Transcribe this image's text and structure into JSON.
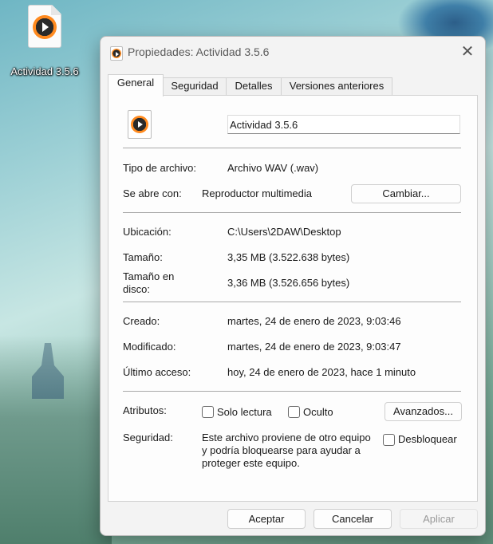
{
  "desktop": {
    "file_label": "Actividad 3.5.6"
  },
  "window": {
    "title": "Propiedades: Actividad 3.5.6",
    "close_glyph": "✕"
  },
  "tabs": [
    {
      "label": "General",
      "active": true
    },
    {
      "label": "Seguridad"
    },
    {
      "label": "Detalles"
    },
    {
      "label": "Versiones anteriores"
    }
  ],
  "general": {
    "file_name": "Actividad 3.5.6",
    "file_type": {
      "label": "Tipo de archivo:",
      "value": "Archivo WAV (.wav)"
    },
    "opens_with": {
      "label": "Se abre con:",
      "value": "Reproductor multimedia",
      "button": "Cambiar..."
    },
    "location": {
      "label": "Ubicación:",
      "value": "C:\\Users\\2DAW\\Desktop"
    },
    "size": {
      "label": "Tamaño:",
      "value": "3,35 MB (3.522.638 bytes)"
    },
    "size_on_disk": {
      "label_line1": "Tamaño en",
      "label_line2": "disco:",
      "value": "3,36 MB (3.526.656 bytes)"
    },
    "created": {
      "label": "Creado:",
      "value": "martes, 24 de enero de 2023, 9:03:46"
    },
    "modified": {
      "label": "Modificado:",
      "value": "martes, 24 de enero de 2023, 9:03:47"
    },
    "accessed": {
      "label": "Último acceso:",
      "value": "hoy, 24 de enero de 2023, hace 1 minuto"
    },
    "attributes": {
      "label": "Atributos:",
      "readonly": "Solo lectura",
      "hidden": "Oculto",
      "advanced_button": "Avanzados..."
    },
    "security": {
      "label": "Seguridad:",
      "line1": "Este archivo proviene de otro equipo",
      "line2": "y podría bloquearse para ayudar a",
      "line3": "proteger este equipo.",
      "unblock": "Desbloquear"
    }
  },
  "footer": {
    "ok": "Aceptar",
    "cancel": "Cancelar",
    "apply": "Aplicar"
  },
  "colors": {
    "accent_text": "#1a1a1a",
    "disabled_text": "#9a9a9a"
  }
}
